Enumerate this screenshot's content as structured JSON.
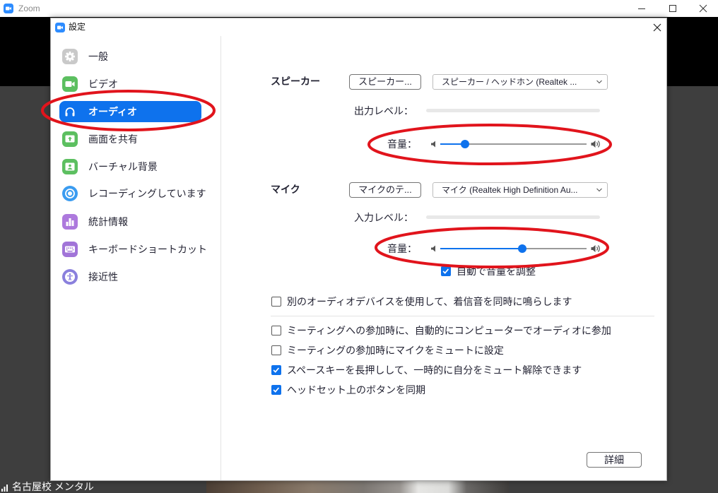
{
  "theme": {
    "accent": "#0e72ed",
    "brand": "#2d8cff"
  },
  "window": {
    "title": "Zoom",
    "app_icon": "zoom-logo-icon",
    "controls": {
      "minimize": "minimize-icon",
      "maximize": "maximize-icon",
      "close": "close-icon"
    }
  },
  "participant": {
    "name": "名古屋校 メンタル",
    "icon": "signal-bars-icon"
  },
  "settings": {
    "title": "設定",
    "title_icon": "zoom-logo-icon",
    "close_icon": "close-icon",
    "sidebar": {
      "items": [
        {
          "label": "一般",
          "icon": "gear-icon",
          "color": "#c9c9c9",
          "selected": false
        },
        {
          "label": "ビデオ",
          "icon": "video-camera-icon",
          "color": "#5cbf60",
          "selected": false
        },
        {
          "label": "オーディオ",
          "icon": "headphones-icon",
          "color": "#ffffff",
          "selected": true
        },
        {
          "label": "画面を共有",
          "icon": "share-screen-icon",
          "color": "#5cbf60",
          "selected": false
        },
        {
          "label": "バーチャル背景",
          "icon": "virtual-background-icon",
          "color": "#5cbf60",
          "selected": false
        },
        {
          "label": "レコーディングしています",
          "icon": "record-icon",
          "color": "#3b9cf0",
          "selected": false
        },
        {
          "label": "統計情報",
          "icon": "statistics-icon",
          "color": "#ad79dd",
          "selected": false
        },
        {
          "label": "キーボードショートカット",
          "icon": "keyboard-icon",
          "color": "#a174d8",
          "selected": false
        },
        {
          "label": "接近性",
          "icon": "accessibility-icon",
          "color": "#8a80dd",
          "selected": false
        }
      ]
    },
    "speaker": {
      "heading": "スピーカー",
      "test_button": "スピーカー...",
      "device": "スピーカー / ヘッドホン (Realtek ...",
      "dropdown_icon": "chevron-down-icon",
      "output_level_label": "出力レベル：",
      "output_level": 0,
      "volume_label": "音量：",
      "volume": 0.17,
      "volume_low_icon": "speaker-low-icon",
      "volume_high_icon": "speaker-high-icon"
    },
    "microphone": {
      "heading": "マイク",
      "test_button": "マイクのテ...",
      "device": "マイク (Realtek High Definition Au...",
      "dropdown_icon": "chevron-down-icon",
      "input_level_label": "入力レベル：",
      "input_level": 0,
      "volume_label": "音量：",
      "volume": 0.56,
      "volume_low_icon": "speaker-low-icon",
      "volume_high_icon": "speaker-high-icon",
      "auto_adjust": {
        "label": "自動で音量を調整",
        "checked": true
      }
    },
    "options": [
      {
        "label": "別のオーディオデバイスを使用して、着信音を同時に鳴らします",
        "checked": false
      },
      {
        "label": "ミーティングへの参加時に、自動的にコンピューターでオーディオに参加",
        "checked": false
      },
      {
        "label": "ミーティングの参加時にマイクをミュートに設定",
        "checked": false
      },
      {
        "label": "スペースキーを長押しして、一時的に自分をミュート解除できます",
        "checked": true
      },
      {
        "label": "ヘッドセット上のボタンを同期",
        "checked": true
      }
    ],
    "advanced_button": "詳細"
  },
  "annotations": {
    "color": "#e1141c"
  }
}
